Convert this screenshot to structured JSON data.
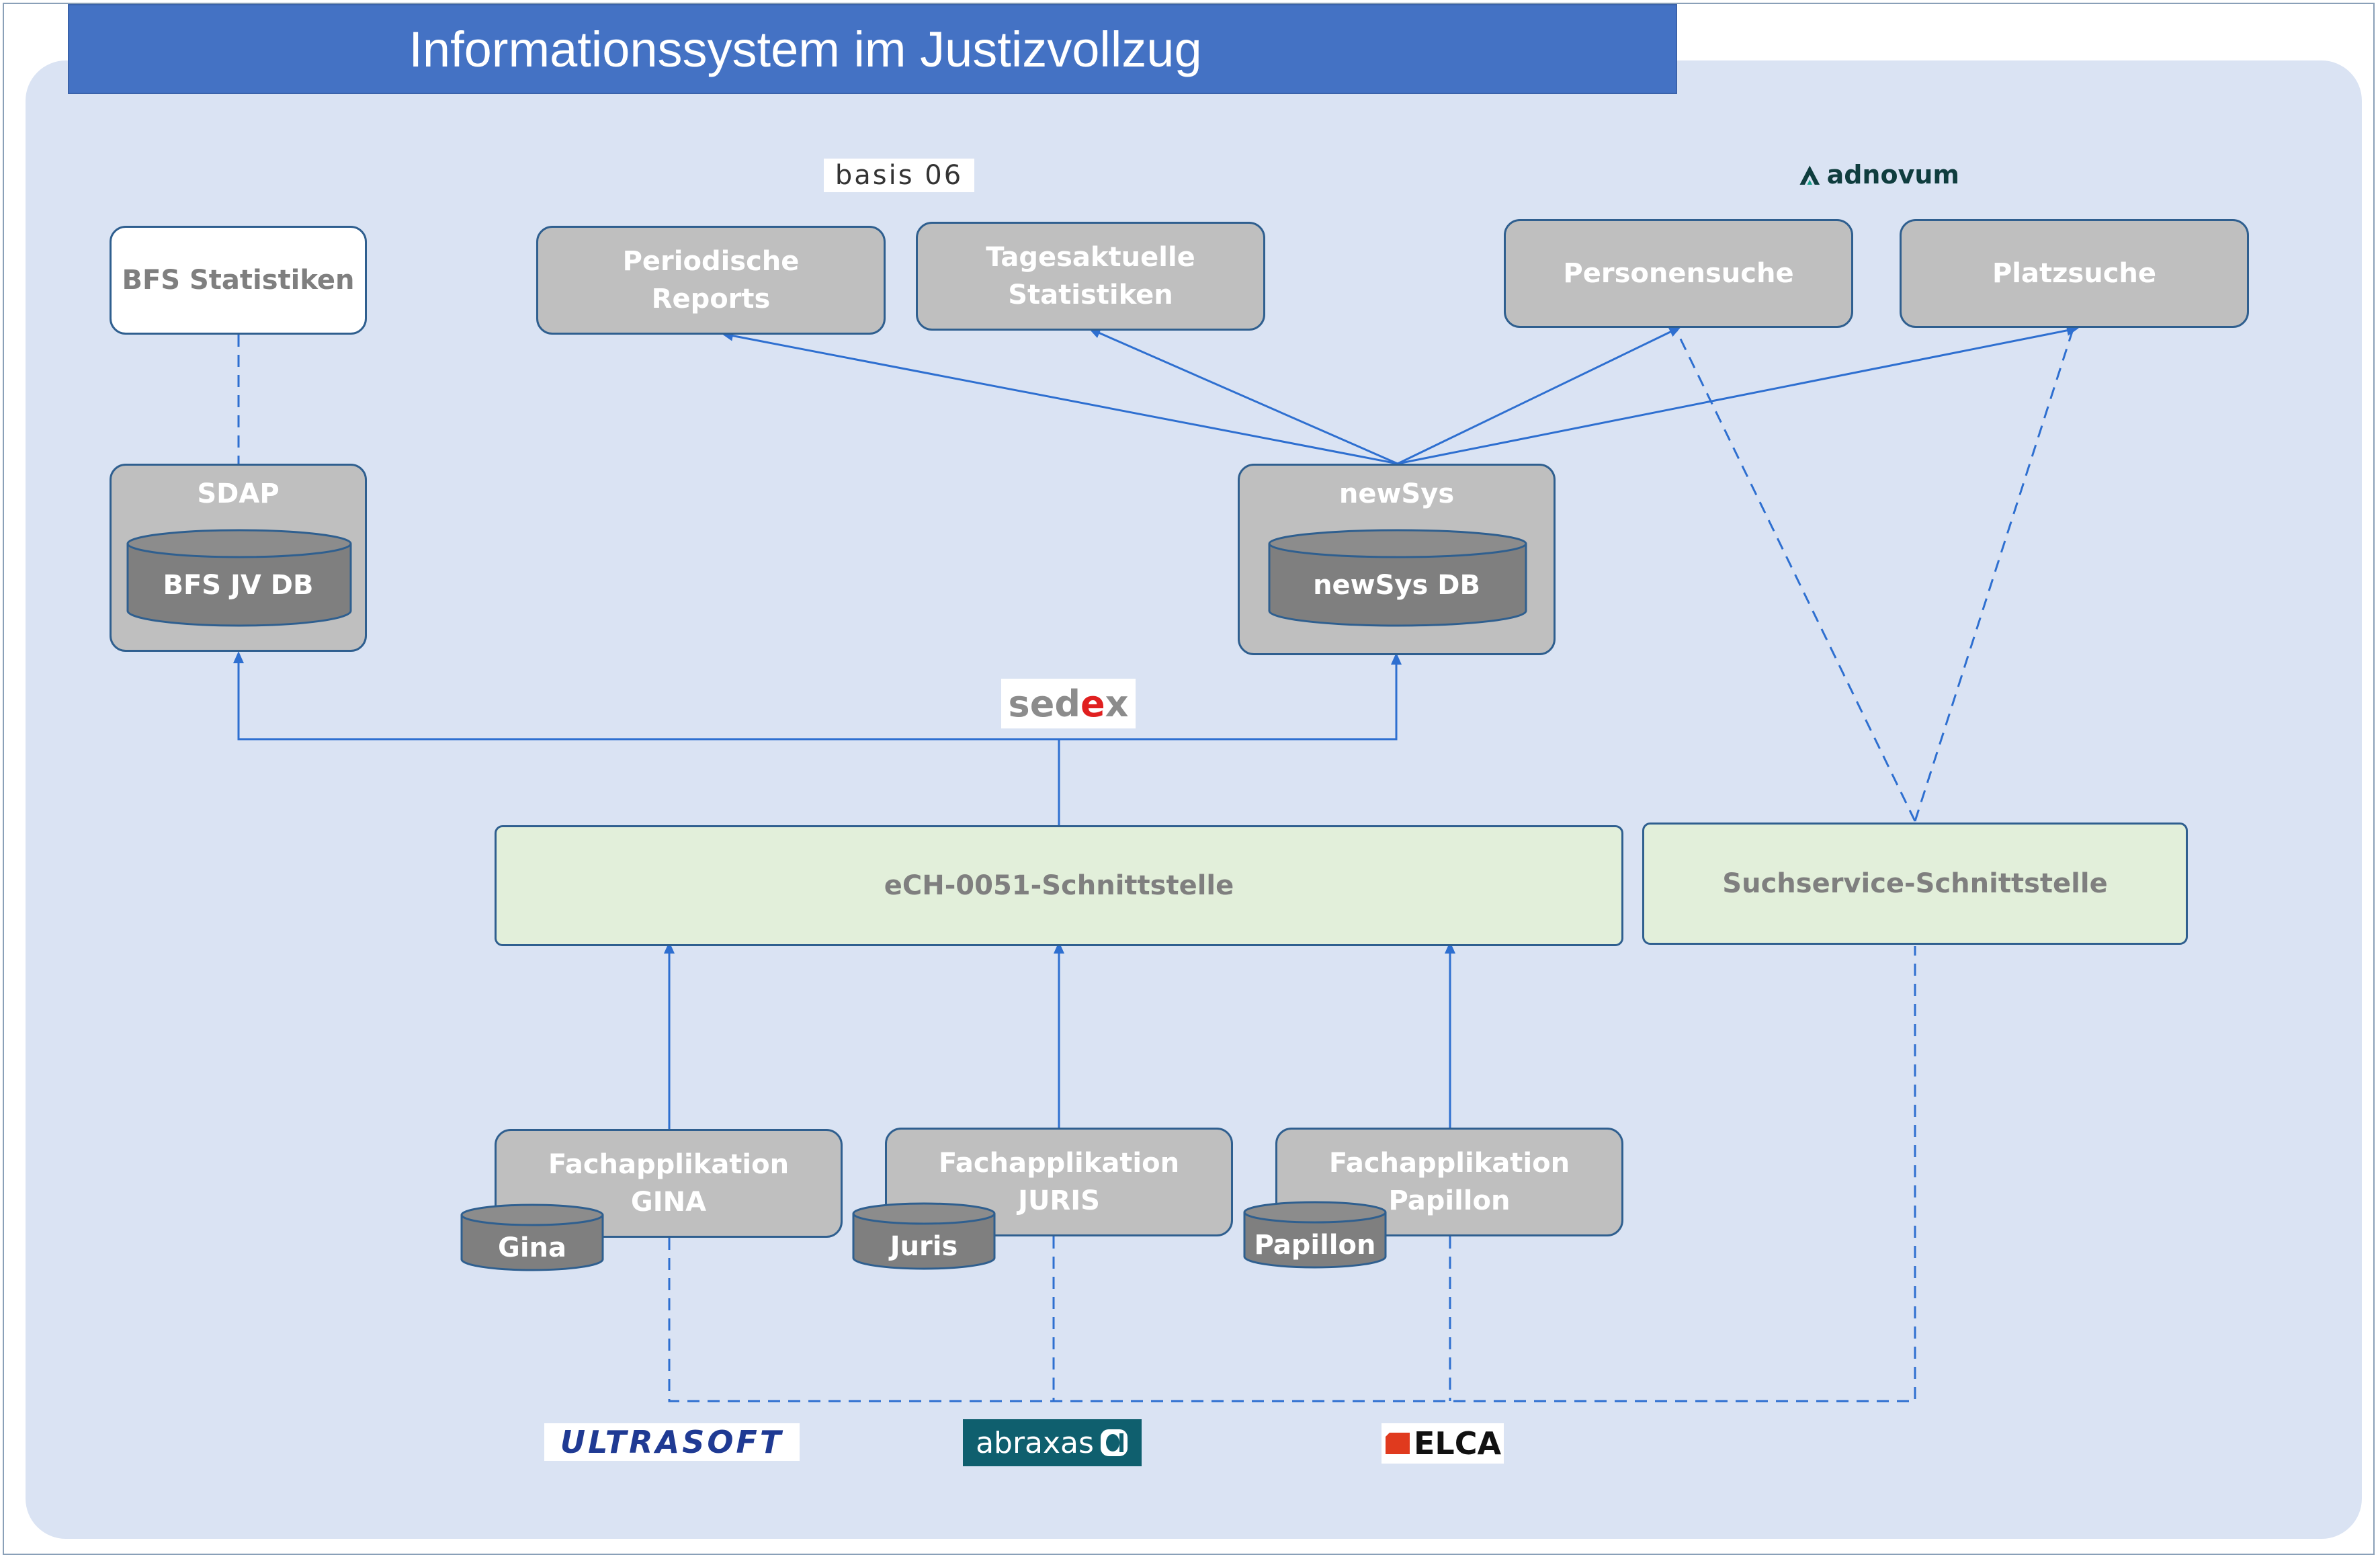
{
  "title": "Informationssystem im Justizvollzug",
  "nodes": {
    "bfs_statistiken": "BFS Statistiken",
    "periodische_reports": "Periodische\nReports",
    "tagesaktuelle_statistiken": "Tagesaktuelle\nStatistiken",
    "personensuche": "Personensuche",
    "platzsuche": "Platzsuche",
    "sdap": "SDAP",
    "bfs_jv_db": "BFS JV DB",
    "newsys": "newSys",
    "newsys_db": "newSys DB",
    "ech_schnittstelle": "eCH-0051-Schnittstelle",
    "suchservice_schnittstelle": "Suchservice-Schnittstelle",
    "fach_gina": "Fachapplikation\nGINA",
    "fach_juris": "Fachapplikation\nJURIS",
    "fach_papillon": "Fachapplikation\nPapillon",
    "db_gina": "Gina",
    "db_juris": "Juris",
    "db_papillon": "Papillon"
  },
  "logos": {
    "basis06": "basis 06",
    "adnovum": "adnovum",
    "sedex": "sedex",
    "ultrasoft": "ULTRASOFT",
    "abraxas": "abraxas",
    "elca": "ELCA"
  },
  "colors": {
    "title_bar": "#4472c4",
    "background": "#dae3f3",
    "node_gray": "#bfbfbf",
    "db_dark": "#7f7f7f",
    "interface_green": "#e2efda",
    "connector": "#2e6fd0"
  }
}
